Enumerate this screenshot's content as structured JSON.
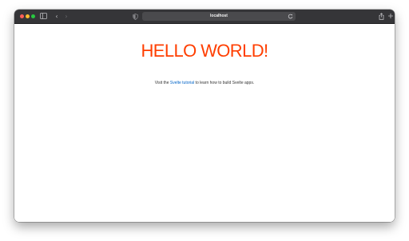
{
  "browser": {
    "address": "localhost"
  },
  "page": {
    "heading": "HELLO WORLD!",
    "intro_before": "Visit the ",
    "intro_link": "Svelte tutorial",
    "intro_after": " to learn how to build Svelte apps."
  },
  "colors": {
    "heading": "#ff3e00",
    "link": "#0064c8",
    "toolbar": "#353538"
  },
  "icons": {
    "sidebar": "sidebar-icon",
    "back": "chevron-left-icon",
    "forward": "chevron-right-icon",
    "privacy": "shield-icon",
    "reload": "reload-icon",
    "share": "share-icon",
    "new_tab": "plus-icon",
    "tab_overview": "tabs-overview-icon"
  }
}
